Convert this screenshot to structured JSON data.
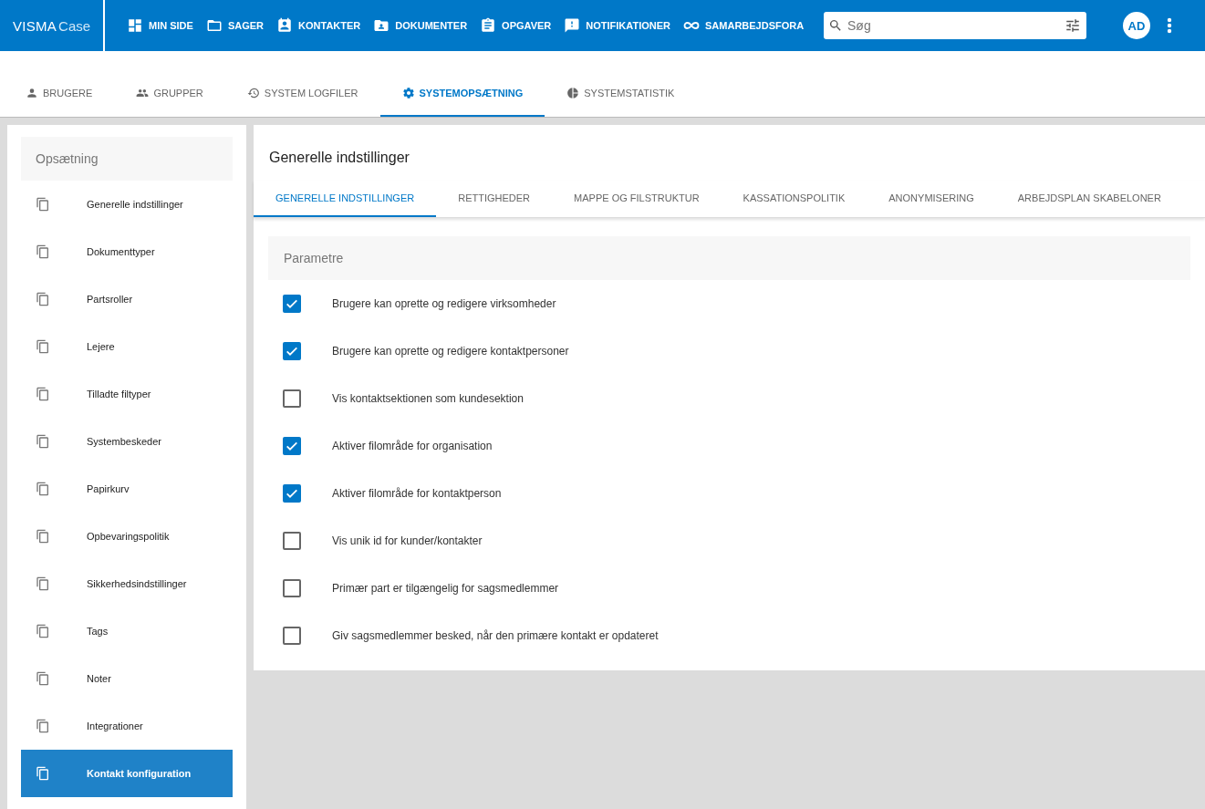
{
  "brand": {
    "name": "VISMA",
    "product": "Case"
  },
  "nav": [
    {
      "label": "MIN SIDE"
    },
    {
      "label": "SAGER"
    },
    {
      "label": "KONTAKTER"
    },
    {
      "label": "DOKUMENTER"
    },
    {
      "label": "OPGAVER"
    },
    {
      "label": "NOTIFIKATIONER"
    },
    {
      "label": "SAMARBEJDSFORA"
    }
  ],
  "search": {
    "placeholder": "Søg"
  },
  "avatar": "AD",
  "admin_tabs": [
    {
      "label": "BRUGERE",
      "selected": false
    },
    {
      "label": "GRUPPER",
      "selected": false
    },
    {
      "label": "SYSTEM LOGFILER",
      "selected": false
    },
    {
      "label": "SYSTEMOPSÆTNING",
      "selected": true
    },
    {
      "label": "SYSTEMSTATISTIK",
      "selected": false
    }
  ],
  "sidebar": {
    "title": "Opsætning",
    "items": [
      {
        "label": "Generelle indstillinger",
        "selected": false
      },
      {
        "label": "Dokumenttyper",
        "selected": false
      },
      {
        "label": "Partsroller",
        "selected": false
      },
      {
        "label": "Lejere",
        "selected": false
      },
      {
        "label": "Tilladte filtyper",
        "selected": false
      },
      {
        "label": "Systembeskeder",
        "selected": false
      },
      {
        "label": "Papirkurv",
        "selected": false
      },
      {
        "label": "Opbevaringspolitik",
        "selected": false
      },
      {
        "label": "Sikkerhedsindstillinger",
        "selected": false
      },
      {
        "label": "Tags",
        "selected": false
      },
      {
        "label": "Noter",
        "selected": false
      },
      {
        "label": "Integrationer",
        "selected": false
      },
      {
        "label": "Kontakt konfiguration",
        "selected": true
      }
    ]
  },
  "content": {
    "title": "Generelle indstillinger",
    "tabs": [
      {
        "label": "GENERELLE INDSTILLINGER",
        "selected": true
      },
      {
        "label": "RETTIGHEDER",
        "selected": false
      },
      {
        "label": "MAPPE OG FILSTRUKTUR",
        "selected": false
      },
      {
        "label": "KASSATIONSPOLITIK",
        "selected": false
      },
      {
        "label": "ANONYMISERING",
        "selected": false
      },
      {
        "label": "ARBEJDSPLAN SKABELONER",
        "selected": false
      }
    ],
    "section_title": "Parametre",
    "options": [
      {
        "label": "Brugere kan oprette og redigere virksomheder",
        "checked": true
      },
      {
        "label": "Brugere kan oprette og redigere kontaktpersoner",
        "checked": true
      },
      {
        "label": "Vis kontaktsektionen som kundesektion",
        "checked": false
      },
      {
        "label": "Aktiver filområde for organisation",
        "checked": true
      },
      {
        "label": "Aktiver filområde for kontaktperson",
        "checked": true
      },
      {
        "label": "Vis unik id for kunder/kontakter",
        "checked": false
      },
      {
        "label": "Primær part er tilgængelig for sagsmedlemmer",
        "checked": false
      },
      {
        "label": "Giv sagsmedlemmer besked, når den primære kontakt er opdateret",
        "checked": false
      }
    ]
  }
}
